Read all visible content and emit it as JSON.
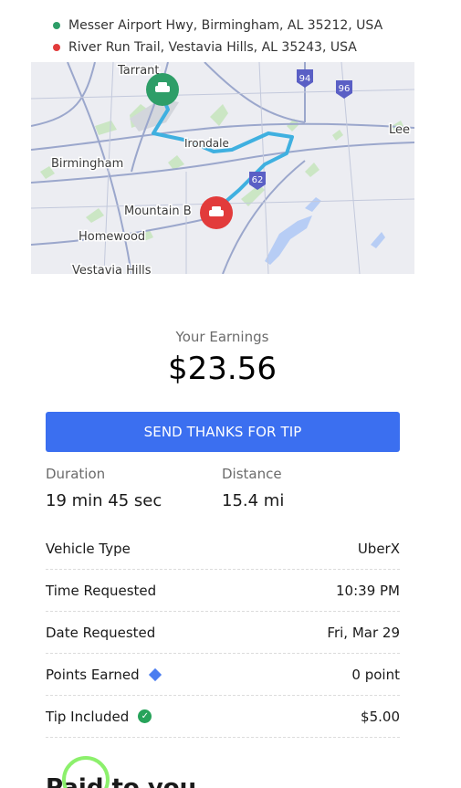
{
  "locations": {
    "pickup": "Messer Airport Hwy, Birmingham, AL 35212, USA",
    "dropoff": "River Run Trail, Vestavia Hills, AL 35243, USA"
  },
  "map": {
    "labels": {
      "tarrant": "Tarrant",
      "irondale": "Irondale",
      "birmingham": "Birmingham",
      "mountain_brook": "Mountain B",
      "homewood": "Homewood",
      "vestavia": "Vestavia Hills",
      "leeds": "Lee"
    },
    "shields": {
      "i94": "94",
      "i96": "96",
      "i62": "62"
    },
    "colors": {
      "route": "#3fb0e0",
      "pickup": "#2e9e68",
      "dropoff": "#e23b3b"
    }
  },
  "earnings": {
    "label": "Your Earnings",
    "amount": "$23.56"
  },
  "tip_button": {
    "label": "SEND THANKS FOR TIP"
  },
  "stats": {
    "duration": {
      "label": "Duration",
      "value": "19 min 45 sec"
    },
    "distance": {
      "label": "Distance",
      "value": "15.4 mi"
    }
  },
  "details": [
    {
      "label": "Vehicle Type",
      "value": "UberX"
    },
    {
      "label": "Time Requested",
      "value": "10:39 PM"
    },
    {
      "label": "Date Requested",
      "value": "Fri, Mar 29"
    },
    {
      "label": "Points Earned",
      "value": "0 point"
    },
    {
      "label": "Tip Included",
      "value": "$5.00"
    }
  ],
  "next_section": "Paid to you",
  "colors": {
    "primary": "#3b6ff0",
    "tip_check": "#27a35a",
    "points_gem": "#4a7df0"
  }
}
